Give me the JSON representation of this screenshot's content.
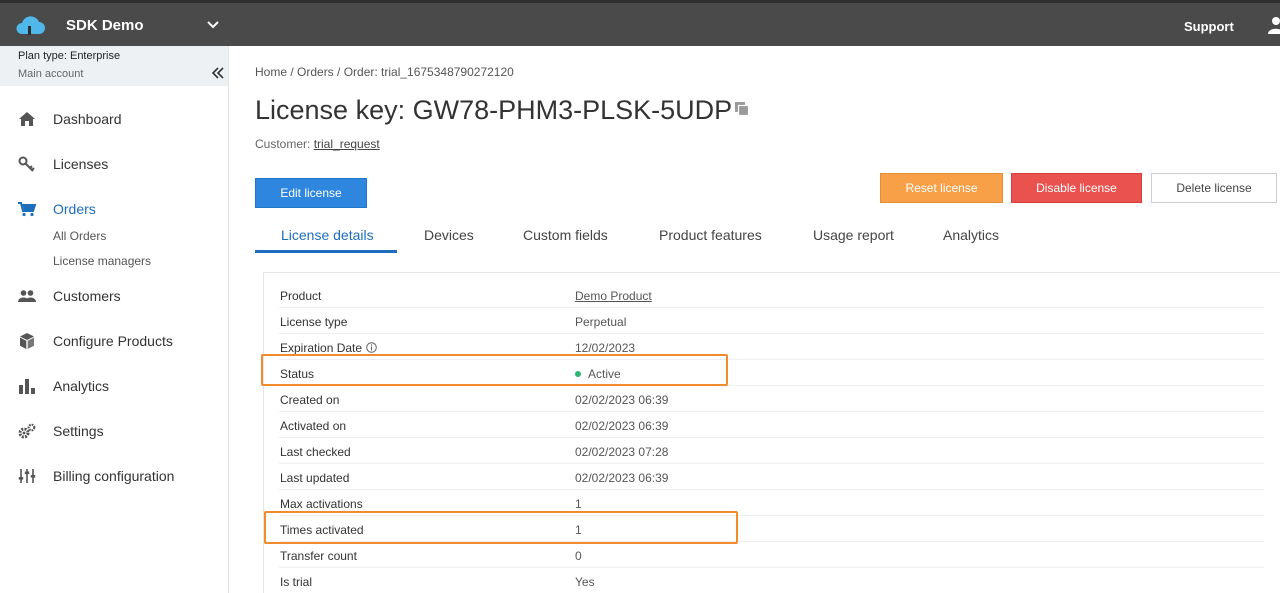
{
  "topbar": {
    "app_name": "SDK Demo",
    "support_label": "Support",
    "icons": {
      "logo": "cloud-logo-icon",
      "app_switch": "chevron-down-icon",
      "user": "user-icon"
    }
  },
  "sidebar": {
    "plan_type": "Plan type: Enterprise",
    "account_name": "Main account",
    "items": [
      {
        "label": "Dashboard",
        "icon": "home-icon"
      },
      {
        "label": "Licenses",
        "icon": "key-icon"
      },
      {
        "label": "Orders",
        "icon": "cart-icon",
        "active": true,
        "sub_items": [
          "All Orders",
          "License managers"
        ]
      },
      {
        "label": "Customers",
        "icon": "users-icon"
      },
      {
        "label": "Configure Products",
        "icon": "box-icon"
      },
      {
        "label": "Analytics",
        "icon": "bar-chart-icon"
      },
      {
        "label": "Settings",
        "icon": "gears-icon"
      },
      {
        "label": "Billing configuration",
        "icon": "sliders-icon"
      }
    ]
  },
  "main": {
    "breadcrumb": "Home / Orders / Order: trial_1675348790272120",
    "title": "License key: GW78-PHM3-PLSK-5UDP",
    "customer_label": "Customer: ",
    "customer_name": "trial_request",
    "buttons": {
      "edit": "Edit license",
      "reset": "Reset license",
      "disable": "Disable license",
      "delete": "Delete license"
    },
    "tabs": [
      "License details",
      "Devices",
      "Custom fields",
      "Product features",
      "Usage report",
      "Analytics"
    ],
    "details": [
      {
        "label": "Product",
        "value": "Demo Product"
      },
      {
        "label": "License type",
        "value": "Perpetual"
      },
      {
        "label": "Expiration Date",
        "value": "12/02/2023"
      },
      {
        "label": "Status",
        "value": "Active"
      },
      {
        "label": "Created on",
        "value": "02/02/2023 06:39"
      },
      {
        "label": "Activated on",
        "value": "02/02/2023 06:39"
      },
      {
        "label": "Last checked",
        "value": "02/02/2023 07:28"
      },
      {
        "label": "Last updated",
        "value": "02/02/2023 06:39"
      },
      {
        "label": "Max activations",
        "value": "1"
      },
      {
        "label": "Times activated",
        "value": "1"
      },
      {
        "label": "Transfer count",
        "value": "0"
      },
      {
        "label": "Is trial",
        "value": "Yes"
      }
    ]
  },
  "colors": {
    "topbar": "#4a4a4a",
    "accent": "#1d6fbd",
    "primary_button": "#2e86de",
    "reset_button": "#f7a047",
    "disable_button": "#e9524e",
    "status_active": "#2bb673",
    "highlight": "#f28a2e"
  }
}
